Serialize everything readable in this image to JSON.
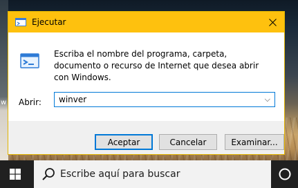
{
  "dialog": {
    "title": "Ejecutar",
    "description": "Escriba el nombre del programa, carpeta, documento o recurso de Internet que desea abrir con Windows.",
    "open_label": "Abrir:",
    "open_value": "winver",
    "buttons": {
      "ok": "Aceptar",
      "cancel": "Cancelar",
      "browse": "Examinar..."
    }
  },
  "taskbar": {
    "search_placeholder": "Escribe aquí para buscar"
  },
  "desktop": {
    "partial_text": "w"
  },
  "colors": {
    "title_bar": "#fec10e",
    "accent": "#0078d7",
    "taskbar": "#202020"
  },
  "icons": [
    "run-icon",
    "close-icon",
    "chevron-down-icon",
    "windows-logo-icon",
    "search-icon",
    "cortana-icon"
  ]
}
